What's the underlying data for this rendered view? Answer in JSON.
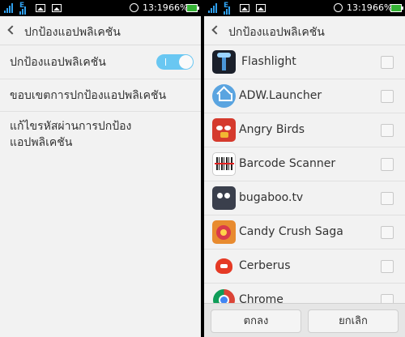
{
  "status_bar": {
    "time": "13:19",
    "battery_percent": "66%",
    "network_label": "E",
    "icons": [
      "signal-icon",
      "edge-signal-icon",
      "image-notification-icon",
      "image-notification-icon",
      "alarm-icon",
      "battery-charging-icon"
    ]
  },
  "left_screen": {
    "title": "ปกป้องแอปพลิเคชัน",
    "settings": [
      {
        "label": "ปกป้องแอปพลิเคชัน",
        "control": "toggle",
        "toggle_on": true
      },
      {
        "label": "ขอบเขตการปกป้องแอปพลิเคชัน"
      },
      {
        "label": "แก้ไขรหัสผ่านการปกป้องแอปพลิเคชัน"
      }
    ]
  },
  "right_screen": {
    "title": "ปกป้องแอปพลิเคชัน",
    "apps": [
      {
        "name": "Flashlight",
        "icon": "flashlight-icon",
        "checked": false
      },
      {
        "name": "ADW.Launcher",
        "icon": "adw-launcher-icon",
        "checked": false
      },
      {
        "name": "Angry Birds",
        "icon": "angry-birds-icon",
        "checked": false
      },
      {
        "name": "Barcode Scanner",
        "icon": "barcode-scanner-icon",
        "checked": false
      },
      {
        "name": "bugaboo.tv",
        "icon": "bugaboo-tv-icon",
        "checked": false
      },
      {
        "name": "Candy Crush Saga",
        "icon": "candy-crush-icon",
        "checked": false
      },
      {
        "name": "Cerberus",
        "icon": "cerberus-icon",
        "checked": false
      },
      {
        "name": "Chrome",
        "icon": "chrome-icon",
        "checked": false
      }
    ],
    "buttons": {
      "ok": "ตกลง",
      "cancel": "ยกเลิก"
    }
  },
  "colors": {
    "accent_toggle": "#69c7f2",
    "signal_blue": "#2fa0ee",
    "background": "#f2f2f2",
    "battery_green": "#35b235"
  }
}
